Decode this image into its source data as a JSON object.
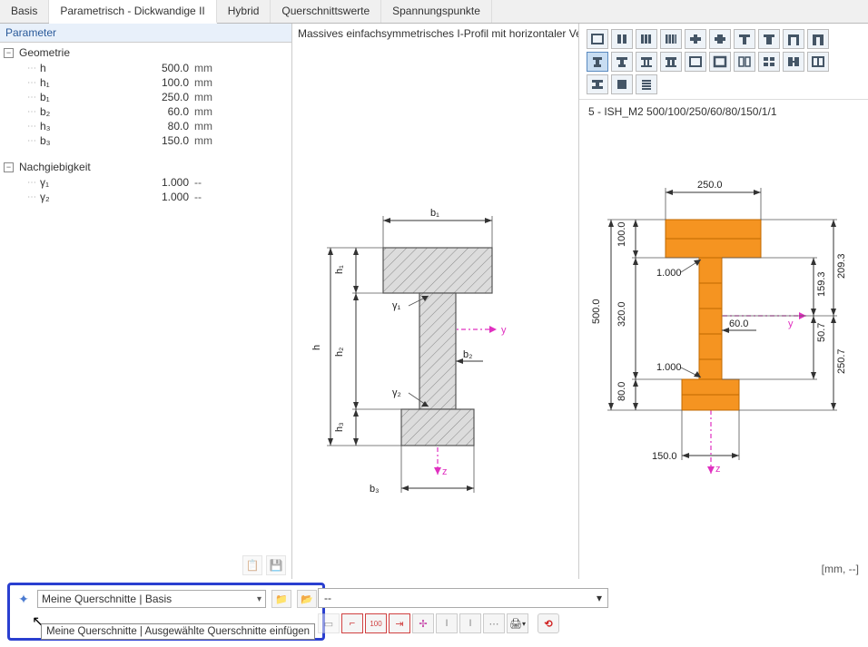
{
  "tabs": [
    "Basis",
    "Parametrisch - Dickwandige II",
    "Hybrid",
    "Querschnittswerte",
    "Spannungspunkte"
  ],
  "active_tab_index": 1,
  "panel_title": "Parameter",
  "groups": {
    "geometry": {
      "title": "Geometrie",
      "rows": [
        {
          "name": "h",
          "val": "500.0",
          "unit": "mm"
        },
        {
          "name": "h₁",
          "val": "100.0",
          "unit": "mm"
        },
        {
          "name": "b₁",
          "val": "250.0",
          "unit": "mm"
        },
        {
          "name": "b₂",
          "val": "60.0",
          "unit": "mm"
        },
        {
          "name": "h₃",
          "val": "80.0",
          "unit": "mm"
        },
        {
          "name": "b₃",
          "val": "150.0",
          "unit": "mm"
        }
      ]
    },
    "flex": {
      "title": "Nachgiebigkeit",
      "rows": [
        {
          "name": "γ₁",
          "val": "1.000",
          "unit": "--"
        },
        {
          "name": "γ₂",
          "val": "1.000",
          "unit": "--"
        }
      ]
    }
  },
  "center_title": "Massives einfachsymmetrisches I-Profil mit horizontaler Ver",
  "diagram_labels": {
    "b1": "b₁",
    "h1": "h₁",
    "h": "h",
    "h2": "h₂",
    "gamma1": "γ₁",
    "gamma2": "γ₂",
    "b2": "b₂",
    "h3": "h₃",
    "b3": "b₃",
    "y": "y",
    "z": "z"
  },
  "right_title": "5 - ISH_M2 500/100/250/60/80/150/1/1",
  "right_dims": {
    "b1": "250.0",
    "h1": "100.0",
    "h": "500.0",
    "h2": "320.0",
    "b2": "60.0",
    "h3": "80.0",
    "b3": "150.0",
    "g1": "1.000",
    "g2": "1.000",
    "r1": "209.3",
    "r1a": "159.3",
    "r2": "250.7",
    "r2a": "50.7",
    "y": "y",
    "z": "z"
  },
  "units_label": "[mm, --]",
  "unit_select": "--",
  "bottom": {
    "combo_label": "Meine Querschnitte | Basis",
    "tooltip": "Meine Querschnitte | Ausgewählte Querschnitte einfügen"
  }
}
